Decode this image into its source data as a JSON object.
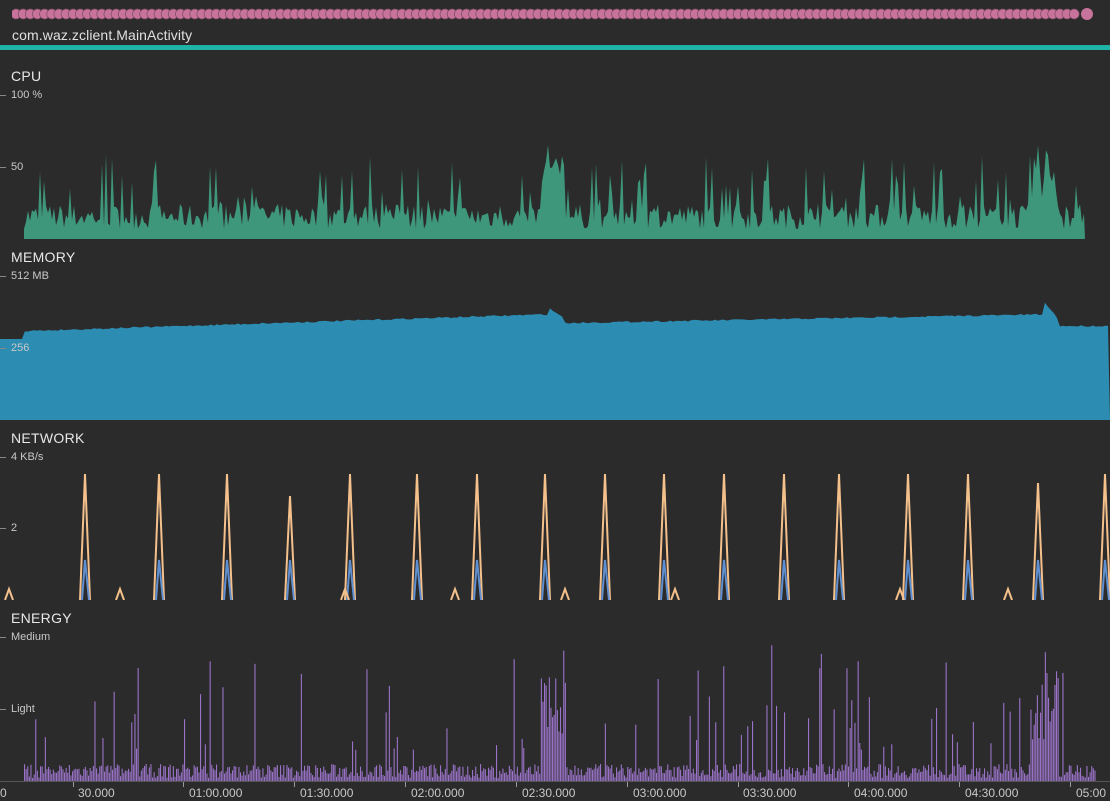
{
  "session": {
    "activity_name": "com.waz.zclient.MainActivity",
    "event_dot_color": "#c8739b",
    "activity_line_color": "#1fb2a6"
  },
  "monitors": {
    "cpu": {
      "title": "CPU",
      "axis_max": "100 %",
      "axis_mid": "50",
      "color": "#3f9d7f"
    },
    "memory": {
      "title": "MEMORY",
      "axis_max": "512 MB",
      "axis_mid": "256",
      "color": "#2d8cb2"
    },
    "network": {
      "title": "NETWORK",
      "axis_max": "4 KB/s",
      "axis_mid": "2",
      "received_color": "#f4c08c",
      "sent_color": "#5f8fd0"
    },
    "energy": {
      "title": "ENERGY",
      "axis_max": "Medium",
      "axis_mid": "Light",
      "color": "#9a73c8"
    }
  },
  "timeline": {
    "labels": [
      "0",
      "30.000",
      "01:00.000",
      "01:30.000",
      "02:00.000",
      "02:30.000",
      "03:00.000",
      "03:30.000",
      "04:00.000",
      "04:30.000",
      "05:00"
    ]
  }
}
